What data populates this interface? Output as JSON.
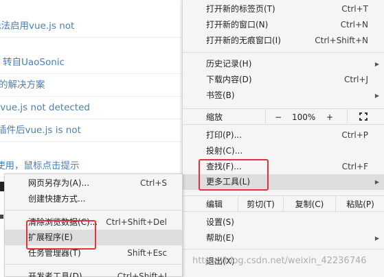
{
  "background_page": {
    "links": [
      "无法启用vue.js not",
      "转自UaoSonic",
      "的解决方案",
      ",vue.js not detected",
      "插件后vue.js is not",
      "使用，鼠标点击提示"
    ]
  },
  "main_menu": {
    "items": [
      {
        "label": "打开新的标签页(T)",
        "shortcut": "Ctrl+T"
      },
      {
        "label": "打开新的窗口(N)",
        "shortcut": "Ctrl+N"
      },
      {
        "label": "打开新的无痕窗口(I)",
        "shortcut": "Ctrl+Shift+N"
      },
      {
        "label": "历史记录(H)",
        "shortcut": ""
      },
      {
        "label": "下载内容(D)",
        "shortcut": "Ctrl+J"
      },
      {
        "label": "书签(B)",
        "shortcut": ""
      },
      {
        "label": "打印(P)...",
        "shortcut": "Ctrl+P"
      },
      {
        "label": "投射(C)...",
        "shortcut": ""
      },
      {
        "label": "查找(F)...",
        "shortcut": "Ctrl+F"
      },
      {
        "label": "更多工具(L)",
        "shortcut": ""
      },
      {
        "label": "设置(S)",
        "shortcut": ""
      },
      {
        "label": "帮助(E)",
        "shortcut": ""
      },
      {
        "label": "退出(X)",
        "shortcut": ""
      }
    ],
    "zoom": {
      "label": "缩放",
      "minus": "−",
      "value": "100%",
      "plus": "+"
    },
    "edit": {
      "label": "编辑",
      "cut": "剪切(T)",
      "copy": "复制(C)",
      "paste": "粘贴(P)"
    }
  },
  "sub_menu": {
    "items": [
      {
        "label": "网页另存为(A)...",
        "shortcut": "Ctrl+S"
      },
      {
        "label": "创建快捷方式...",
        "shortcut": ""
      },
      {
        "label": "清除浏览数据(C)...",
        "shortcut": "Ctrl+Shift+Del"
      },
      {
        "label": "扩展程序(E)",
        "shortcut": ""
      },
      {
        "label": "任务管理器(T)",
        "shortcut": "Shift+Esc"
      },
      {
        "label": "开发者工具(D)",
        "shortcut": "Ctrl+Shift+I"
      }
    ]
  },
  "watermark": "https://blog.csdn.net/weixin_42236746",
  "icons": {
    "submenu_arrow": "chevron-right-icon",
    "fullscreen": "fullscreen-icon"
  },
  "colors": {
    "annotation_box": "#e8303a",
    "highlight": "#dedede",
    "link": "#4a7fb5"
  }
}
